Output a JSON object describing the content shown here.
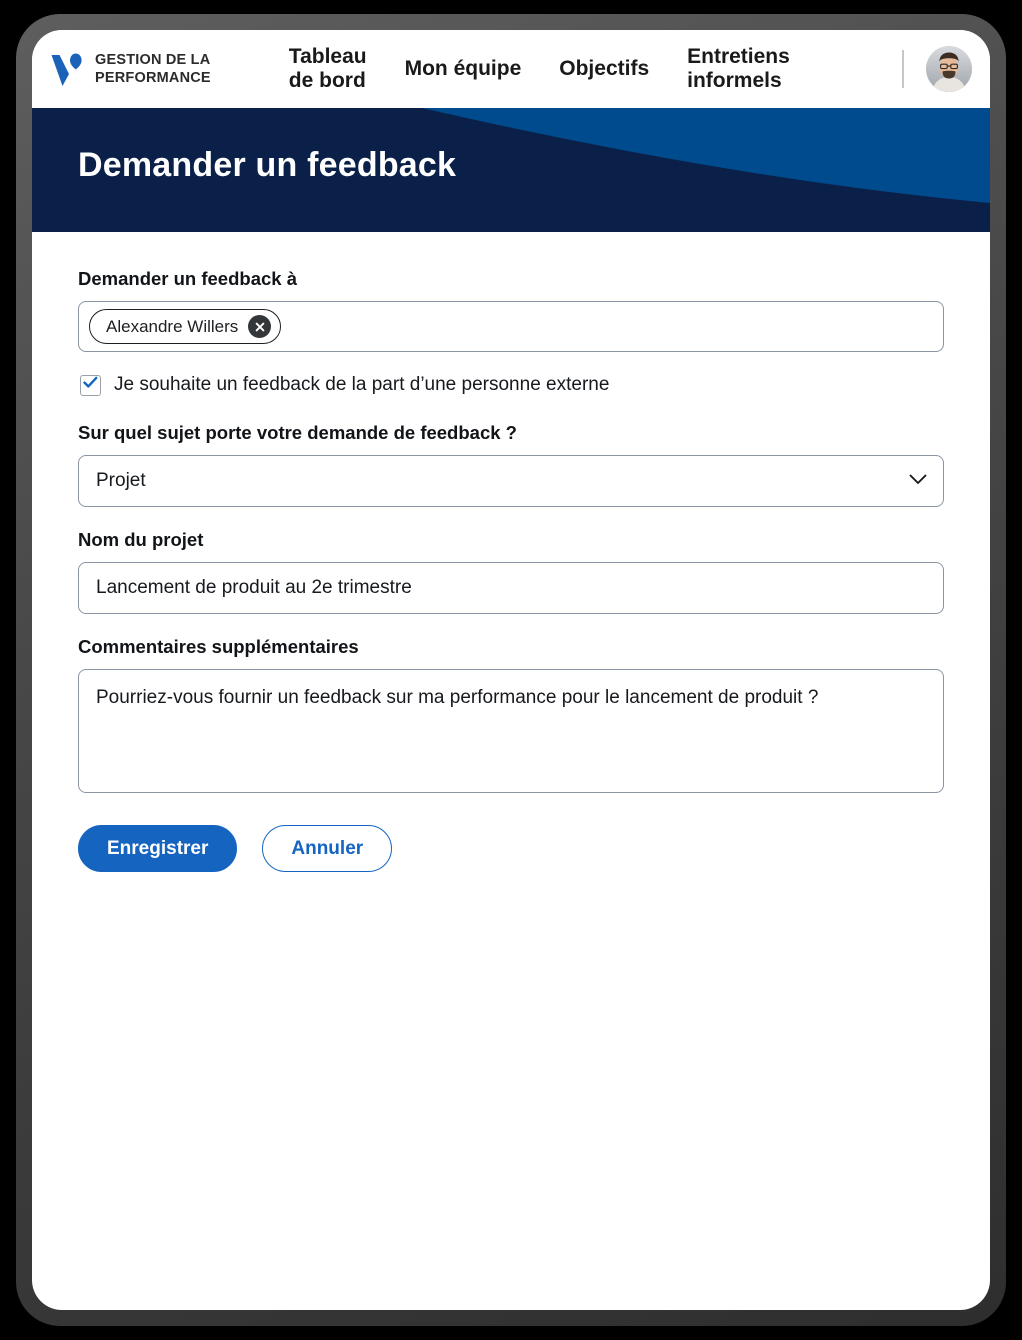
{
  "brand": {
    "name": "GESTION DE LA\nPERFORMANCE",
    "logo_icon": "v-logo-icon"
  },
  "nav": {
    "links": [
      {
        "label": "Tableau\nde bord"
      },
      {
        "label": "Mon équipe"
      },
      {
        "label": "Objectifs"
      },
      {
        "label": "Entretiens\ninformels"
      }
    ],
    "avatar_icon": "user-avatar"
  },
  "hero": {
    "title": "Demander un feedback",
    "bg_dark": "#0a2048",
    "bg_light": "#004b8d"
  },
  "form": {
    "recipient": {
      "label": "Demander un feedback à",
      "chips": [
        {
          "name": "Alexandre Willers",
          "remove_icon": "close-icon"
        }
      ],
      "placeholder": ""
    },
    "external": {
      "label": "Je souhaite un feedback de la part d’une personne externe",
      "checked": true,
      "check_icon": "check-icon"
    },
    "subject": {
      "label": "Sur quel sujet porte votre demande de feedback ?",
      "value": "Projet",
      "chevron_icon": "chevron-down-icon",
      "options": [
        "Projet"
      ]
    },
    "project": {
      "label": "Nom du projet",
      "value": "Lancement de produit au 2e trimestre",
      "placeholder": ""
    },
    "comments": {
      "label": "Commentaires supplémentaires",
      "value": "Pourriez-vous fournir un feedback sur ma performance pour le lancement de produit ?",
      "placeholder": ""
    }
  },
  "actions": {
    "save_label": "Enregistrer",
    "cancel_label": "Annuler"
  },
  "colors": {
    "accent_blue": "#1565c0",
    "navy": "#0a2048",
    "border_gray": "#8b94a3"
  }
}
